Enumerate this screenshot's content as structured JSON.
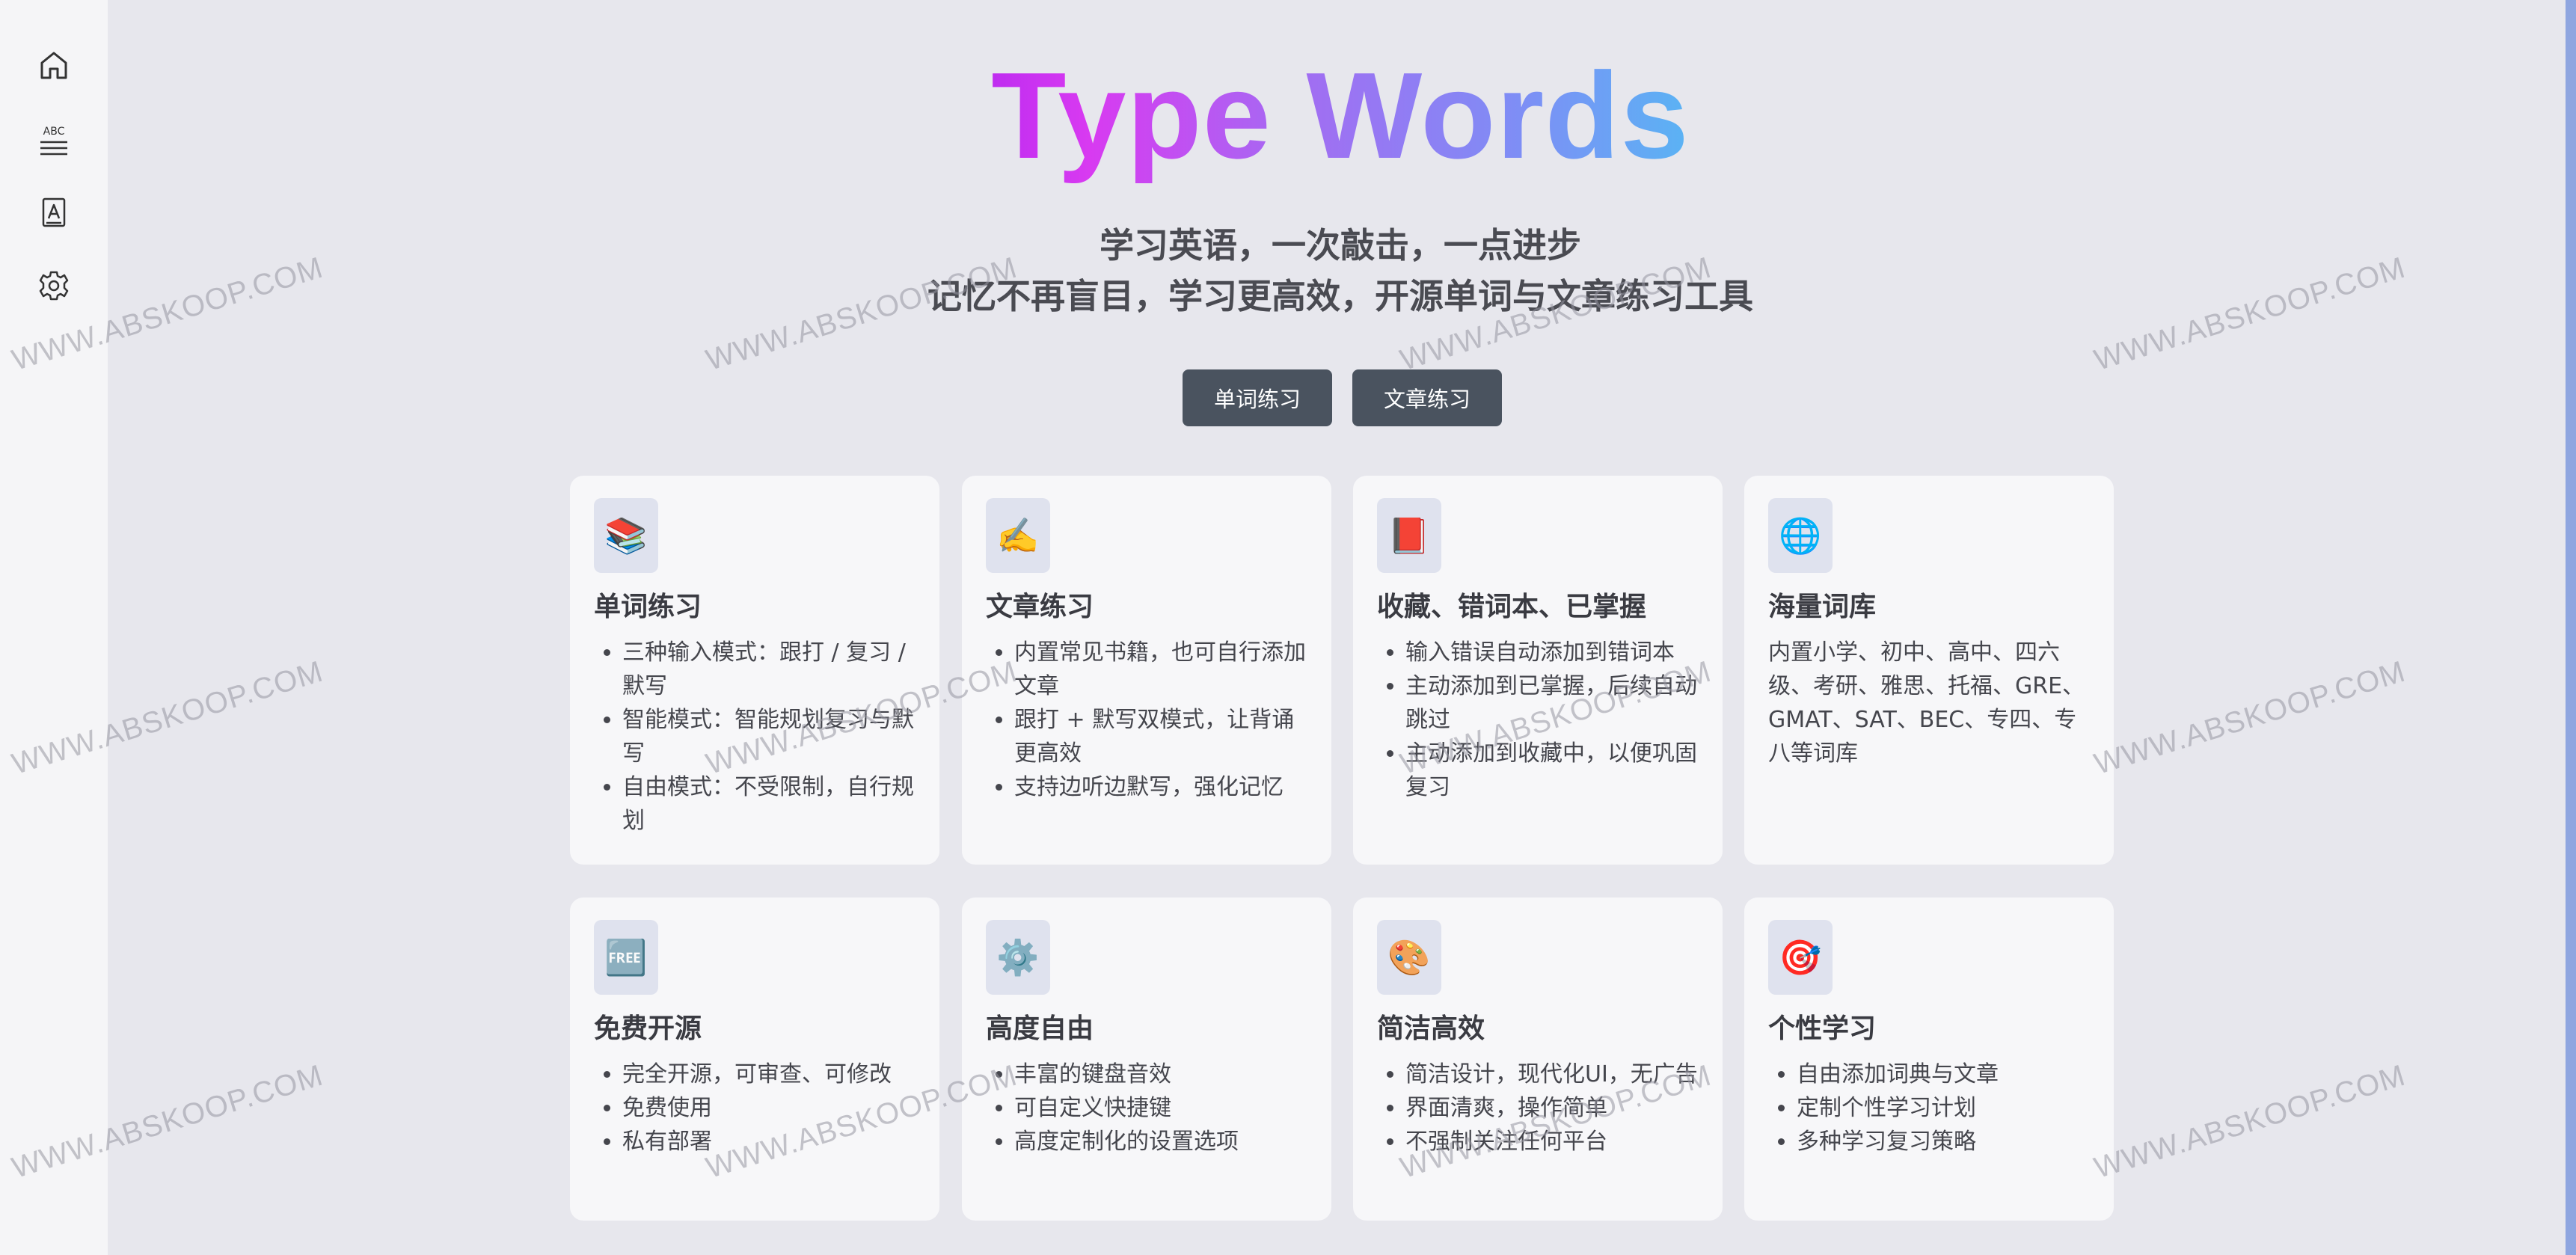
{
  "sidebar": {
    "items": [
      {
        "icon": "home-icon"
      },
      {
        "icon": "abc-dictation-icon"
      },
      {
        "icon": "article-book-icon"
      },
      {
        "icon": "gear-icon"
      }
    ]
  },
  "hero": {
    "title": "Type Words",
    "subtitle1": "学习英语，一次敲击，一点进步",
    "subtitle2": "记忆不再盲目，学习更高效，开源单词与文章练习工具"
  },
  "buttons": {
    "word_practice": "单词练习",
    "article_practice": "文章练习"
  },
  "features": [
    {
      "icon": "📚",
      "title": "单词练习",
      "items": [
        "三种输入模式：跟打 / 复习 / 默写",
        "智能模式：智能规划复习与默写",
        "自由模式：不受限制，自行规划"
      ]
    },
    {
      "icon": "✍️",
      "title": "文章练习",
      "items": [
        "内置常见书籍，也可自行添加文章",
        "跟打 + 默写双模式，让背诵更高效",
        "支持边听边默写，强化记忆"
      ]
    },
    {
      "icon": "📕",
      "title": "收藏、错词本、已掌握",
      "items": [
        "输入错误自动添加到错词本",
        "主动添加到已掌握，后续自动跳过",
        "主动添加到收藏中，以便巩固复习"
      ]
    },
    {
      "icon": "🌐",
      "title": "海量词库",
      "desc": "内置小学、初中、高中、四六级、考研、雅思、托福、GRE、GMAT、SAT、BEC、专四、专八等词库"
    },
    {
      "icon": "🆓",
      "title": "免费开源",
      "items": [
        "完全开源，可审查、可修改",
        "免费使用",
        "私有部署"
      ]
    },
    {
      "icon": "⚙️",
      "title": "高度自由",
      "items": [
        "丰富的键盘音效",
        "可自定义快捷键",
        "高度定制化的设置选项"
      ]
    },
    {
      "icon": "🎨",
      "title": "简洁高效",
      "items": [
        "简洁设计，现代化UI，无广告",
        "界面清爽，操作简单",
        "不强制关注任何平台"
      ]
    },
    {
      "icon": "🎯",
      "title": "个性学习",
      "items": [
        "自由添加词典与文章",
        "定制个性学习计划",
        "多种学习复习策略"
      ]
    }
  ],
  "watermark": "WWW.ABSKOOP.COM"
}
